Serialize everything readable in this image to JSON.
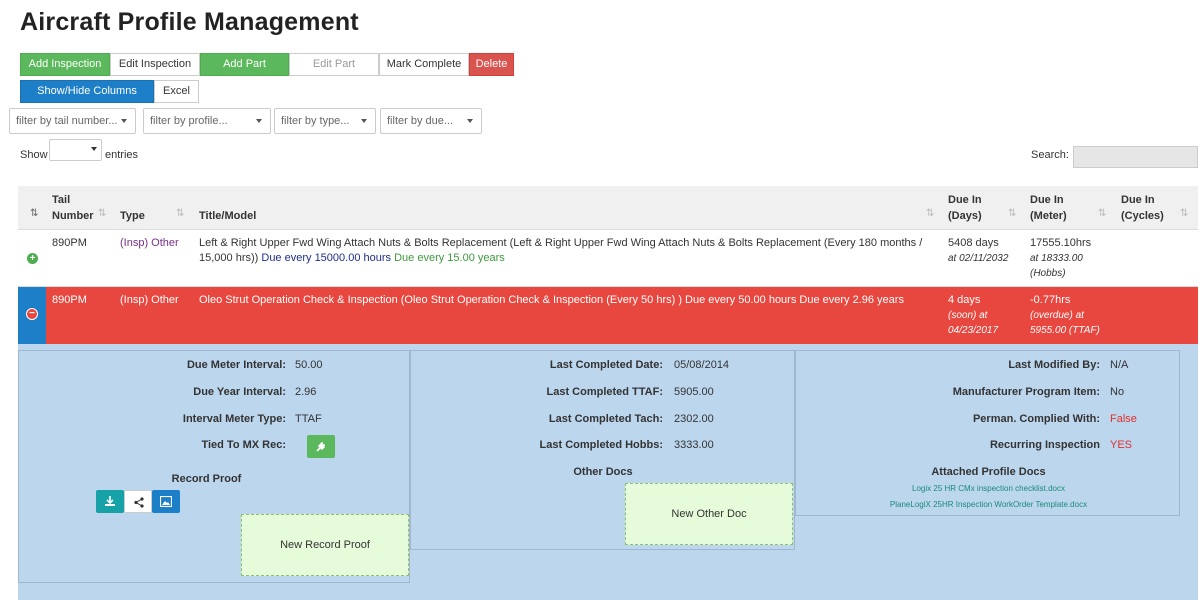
{
  "page_title": "Aircraft Profile Management",
  "toolbar": {
    "add_inspection": "Add Inspection",
    "edit_inspection": "Edit Inspection",
    "add_part": "Add Part",
    "edit_part": "Edit Part",
    "mark_complete": "Mark Complete",
    "delete": "Delete",
    "show_hide_columns": "Show/Hide Columns",
    "excel": "Excel"
  },
  "filters": {
    "tail": "filter by tail number...",
    "profile": "filter by profile...",
    "type": "filter by type...",
    "due": "filter by due..."
  },
  "length": {
    "show": "Show",
    "entries": "entries"
  },
  "search": {
    "label": "Search:"
  },
  "columns": {
    "tail_number": [
      "Tail",
      "Number"
    ],
    "type": "Type",
    "title_model": "Title/Model",
    "due_in_days": [
      "Due In",
      "(Days)"
    ],
    "due_in_meter": [
      "Due In",
      "(Meter)"
    ],
    "due_in_cycles": [
      "Due In",
      "(Cycles)"
    ]
  },
  "rows": [
    {
      "tail": "890PM",
      "type": "(Insp) Other",
      "title_main": "Left & Right Upper Fwd Wing Attach Nuts & Bolts Replacement (Left & Right Upper Fwd Wing Attach Nuts & Bolts Replacement (Every 180 months /",
      "title_cont": "15,000 hrs))",
      "due_hours": "Due every 15000.00 hours",
      "due_years": "Due every 15.00 years",
      "days": "5408 days",
      "days_sub": "at 02/11/2032",
      "meter": "17555.10hrs",
      "meter_sub1": "at 18333.00",
      "meter_sub2": "(Hobbs)"
    },
    {
      "tail": "890PM",
      "type": "(Insp) Other",
      "title": "Oleo Strut Operation Check & Inspection (Oleo Strut Operation Check & Inspection (Every 50 hrs) ) Due every 50.00 hours Due every 2.96 years",
      "days": "4 days",
      "days_sub1": "(soon) at",
      "days_sub2": "04/23/2017",
      "meter": "-0.77hrs",
      "meter_sub1": "(overdue) at",
      "meter_sub2": "5955.00 (TTAF)"
    }
  ],
  "detail": {
    "col1": {
      "due_meter_interval_label": "Due Meter Interval:",
      "due_meter_interval": "50.00",
      "due_year_interval_label": "Due Year Interval:",
      "due_year_interval": "2.96",
      "interval_meter_type_label": "Interval Meter Type:",
      "interval_meter_type": "TTAF",
      "tied_to_mx_label": "Tied To MX Rec:",
      "record_proof_label": "Record Proof",
      "new_record_proof": "New Record Proof"
    },
    "col2": {
      "last_completed_date_label": "Last Completed Date:",
      "last_completed_date": "05/08/2014",
      "last_completed_ttaf_label": "Last Completed TTAF:",
      "last_completed_ttaf": "5905.00",
      "last_completed_tach_label": "Last Completed Tach:",
      "last_completed_tach": "2302.00",
      "last_completed_hobbs_label": "Last Completed Hobbs:",
      "last_completed_hobbs": "3333.00",
      "other_docs_label": "Other Docs",
      "new_other_doc": "New Other Doc"
    },
    "col3": {
      "last_modified_by_label": "Last Modified By:",
      "last_modified_by": "N/A",
      "manufacturer_program_item_label": "Manufacturer Program Item:",
      "manufacturer_program_item": "No",
      "perman_complied_with_label": "Perman. Complied With:",
      "perman_complied_with": "False",
      "recurring_inspection_label": "Recurring Inspection",
      "recurring_inspection": "YES",
      "attached_profile_docs_label": "Attached Profile Docs",
      "docs": [
        "Logix 25 HR CMx inspection checklist.docx",
        "PlaneLogiX 25HR Inspection WorkOrder Template.docx"
      ]
    }
  },
  "icons": {
    "expand": "plus-circle-icon",
    "collapse": "minus-circle-icon",
    "download": "download-icon",
    "share": "share-icon",
    "image": "image-icon",
    "plug": "plug-icon"
  },
  "colors": {
    "green": "#5cb85c",
    "red": "#d9534f",
    "blue": "#1d7fc7",
    "highlight_row": "#e8473f",
    "detail_bg": "#bcd6ee"
  }
}
